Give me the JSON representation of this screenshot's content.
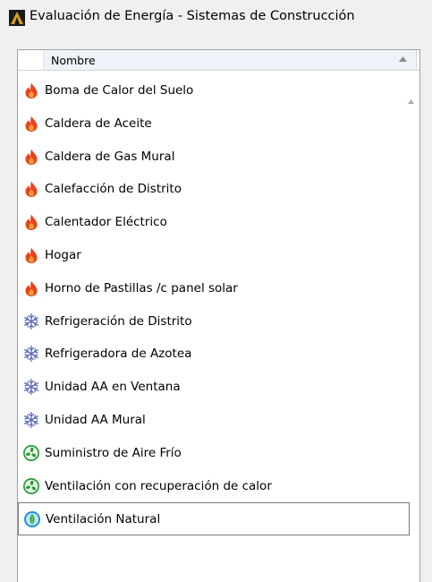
{
  "window": {
    "title": "Evaluación de Energía - Sistemas de Construcción"
  },
  "list": {
    "column_header": "Nombre",
    "items": [
      {
        "label": "Boma de Calor del Suelo",
        "icon": "flame-icon"
      },
      {
        "label": "Caldera de Aceite",
        "icon": "flame-icon"
      },
      {
        "label": "Caldera de Gas Mural",
        "icon": "flame-icon"
      },
      {
        "label": "Calefacción de Distrito",
        "icon": "flame-icon"
      },
      {
        "label": "Calentador Eléctrico",
        "icon": "flame-icon"
      },
      {
        "label": "Hogar",
        "icon": "flame-icon"
      },
      {
        "label": "Horno de Pastillas /c panel solar",
        "icon": "flame-icon"
      },
      {
        "label": "Refrigeración de Distrito",
        "icon": "snowflake-icon"
      },
      {
        "label": "Refrigeradora de Azotea",
        "icon": "snowflake-icon"
      },
      {
        "label": "Unidad AA en Ventana",
        "icon": "snowflake-icon"
      },
      {
        "label": "Unidad AA Mural",
        "icon": "snowflake-icon"
      },
      {
        "label": "Suministro de Aire Frío",
        "icon": "fan-icon"
      },
      {
        "label": "Ventilación con recuperación de calor",
        "icon": "fan-icon"
      },
      {
        "label": "Ventilación Natural",
        "icon": "natural-ventilation-icon",
        "selected": true
      }
    ]
  },
  "colors": {
    "flame": "#e8421c",
    "snowflake": "#5b6fb5",
    "fan": "#2a9a3a",
    "natural": "#2a8fd8"
  }
}
